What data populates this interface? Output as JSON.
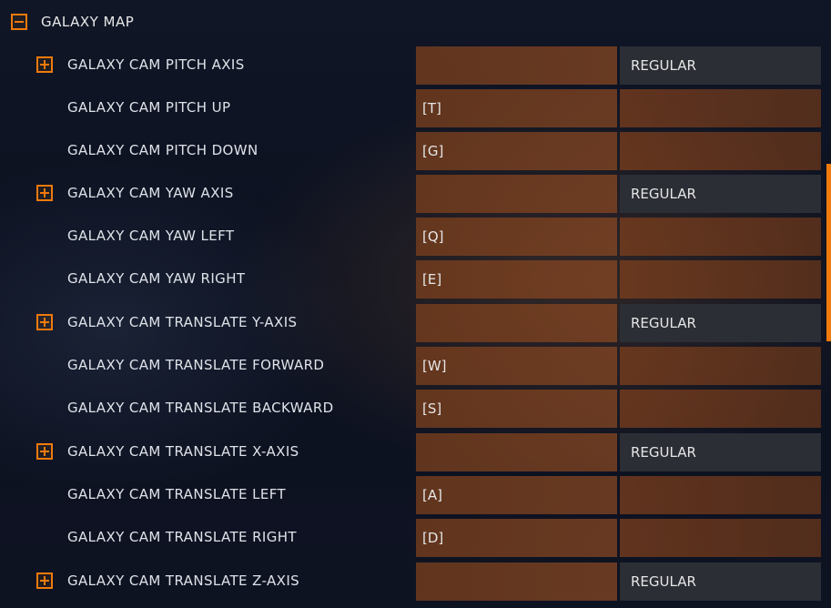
{
  "section": {
    "title": "GALAXY MAP",
    "icon": "minus-box-icon"
  },
  "colors": {
    "accent": "#f07a0c",
    "binding_cell": "#7e4420",
    "mode_cell": "#2b2e35"
  },
  "rows": [
    {
      "label": "GALAXY CAM PITCH AXIS",
      "primary": "",
      "secondary": "REGULAR"
    },
    {
      "label": "GALAXY CAM PITCH UP",
      "primary": "[T]",
      "secondary": ""
    },
    {
      "label": "GALAXY CAM PITCH DOWN",
      "primary": "[G]",
      "secondary": ""
    },
    {
      "label": "GALAXY CAM YAW AXIS",
      "primary": "",
      "secondary": "REGULAR"
    },
    {
      "label": "GALAXY CAM YAW LEFT",
      "primary": "[Q]",
      "secondary": ""
    },
    {
      "label": "GALAXY CAM YAW RIGHT",
      "primary": "[E]",
      "secondary": ""
    },
    {
      "label": "GALAXY CAM TRANSLATE Y-AXIS",
      "primary": "",
      "secondary": "REGULAR"
    },
    {
      "label": "GALAXY CAM TRANSLATE FORWARD",
      "primary": "[W]",
      "secondary": ""
    },
    {
      "label": "GALAXY CAM TRANSLATE BACKWARD",
      "primary": "[S]",
      "secondary": ""
    },
    {
      "label": "GALAXY CAM TRANSLATE X-AXIS",
      "primary": "",
      "secondary": "REGULAR"
    },
    {
      "label": "GALAXY CAM TRANSLATE LEFT",
      "primary": "[A]",
      "secondary": ""
    },
    {
      "label": "GALAXY CAM TRANSLATE RIGHT",
      "primary": "[D]",
      "secondary": ""
    },
    {
      "label": "GALAXY CAM TRANSLATE Z-AXIS",
      "primary": "",
      "secondary": "REGULAR"
    }
  ]
}
